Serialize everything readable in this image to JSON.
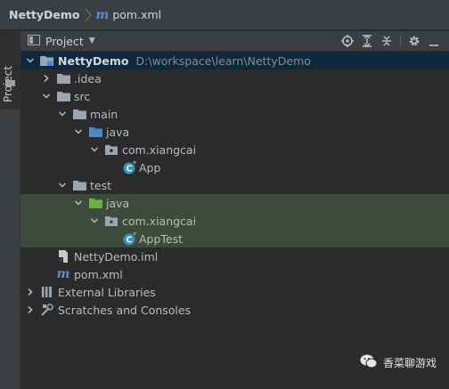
{
  "breadcrumb": {
    "project": "NettyDemo",
    "file": "pom.xml",
    "file_icon": "maven-m-icon"
  },
  "side_stripe": {
    "tab_label": "Project"
  },
  "panel": {
    "title": "Project",
    "tools": [
      "locate-icon",
      "expand-all-icon",
      "collapse-all-icon",
      "settings-icon",
      "hide-icon"
    ]
  },
  "tree": {
    "root": {
      "name": "NettyDemo",
      "path": "D:\\workspace\\learn\\NettyDemo"
    },
    "idea": ".idea",
    "src": "src",
    "main": "main",
    "main_java": "java",
    "main_pkg": "com.xiangcai",
    "app": "App",
    "test": "test",
    "test_java": "java",
    "test_pkg": "com.xiangcai",
    "app_test": "AppTest",
    "iml": "NettyDemo.iml",
    "pom": "pom.xml",
    "ext_libs": "External Libraries",
    "scratches": "Scratches and Consoles"
  },
  "watermark": {
    "text": "香菜聊游戏"
  },
  "colors": {
    "selection": "#0d293e",
    "test_highlight": "#3d4b3d",
    "source_folder": "#4a88c7",
    "test_folder": "#62b543"
  }
}
